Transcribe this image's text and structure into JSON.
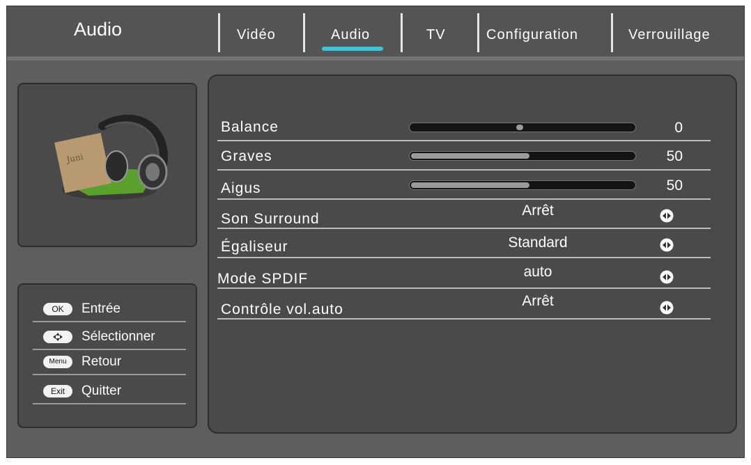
{
  "header": {
    "title": "Audio",
    "tabs": [
      {
        "label": "Vidéo"
      },
      {
        "label": "Audio"
      },
      {
        "label": "TV"
      },
      {
        "label": "Configuration"
      },
      {
        "label": "Verrouillage"
      }
    ],
    "active_tab": "Audio"
  },
  "settings": {
    "balance": {
      "label": "Balance",
      "value": "0"
    },
    "graves": {
      "label": "Graves",
      "value": "50"
    },
    "aigus": {
      "label": "Aigus",
      "value": "50"
    },
    "surround": {
      "label": "Son Surround",
      "value": "Arrêt"
    },
    "egaliseur": {
      "label": "Égaliseur",
      "value": "Standard"
    },
    "spdif": {
      "label": "Mode SPDIF",
      "value": "auto"
    },
    "volauto": {
      "label": "Contrôle vol.auto",
      "value": "Arrêt"
    }
  },
  "help": {
    "ok": {
      "key": "OK",
      "label": "Entrée"
    },
    "select": {
      "key": "",
      "label": "Sélectionner"
    },
    "menu": {
      "key": "Menu",
      "label": "Retour"
    },
    "exit": {
      "key": "Exit",
      "label": "Quitter"
    }
  },
  "icons": {
    "audio_illustration": "headphones-illustration-icon",
    "nav": "left-right-arrows-icon",
    "dpad": "dpad-icon"
  },
  "colors": {
    "accent": "#38c8dc",
    "background": "#5e5e5e",
    "panel": "#4a4a4a"
  }
}
